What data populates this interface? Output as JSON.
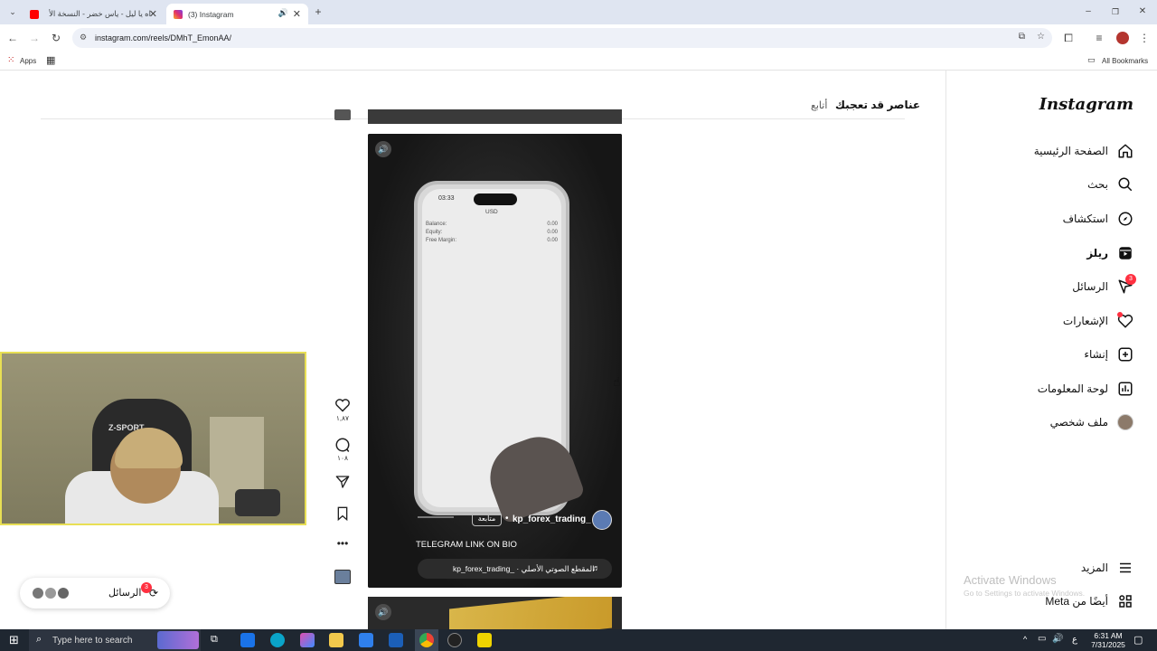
{
  "browser": {
    "tabs": [
      {
        "title": "اه يا ليل - ياس خضر - النسخة الأ"
      },
      {
        "title": "(3) Instagram"
      }
    ],
    "url": "instagram.com/reels/DMhT_EmonAA/",
    "bookmarks": {
      "apps": "Apps",
      "all_bookmarks": "All Bookmarks"
    }
  },
  "sidebar": {
    "logo": "Instagram",
    "items": [
      {
        "label": "الصفحة الرئيسية",
        "icon": "home-icon"
      },
      {
        "label": "بحث",
        "icon": "search-icon"
      },
      {
        "label": "استكشاف",
        "icon": "compass-icon"
      },
      {
        "label": "ريلز",
        "icon": "reels-icon"
      },
      {
        "label": "الرسائل",
        "icon": "messenger-icon",
        "badge": "3"
      },
      {
        "label": "الإشعارات",
        "icon": "heart-icon"
      },
      {
        "label": "إنشاء",
        "icon": "plus-square-icon"
      },
      {
        "label": "لوحة المعلومات",
        "icon": "dashboard-icon"
      },
      {
        "label": "ملف شخصي",
        "icon": "avatar-icon"
      }
    ],
    "more": "المزيد",
    "also_from_meta": "أيضًا من Meta"
  },
  "suggested": {
    "title": "عناصر قد تعجبك",
    "follow": "أتابع"
  },
  "reel": {
    "username": "kp_forex_trading_",
    "follow_label": "متابعة",
    "caption": "TELEGRAM LINK ON BIO",
    "audio": "kp_forex_trading_ · المقطع الصوتي الأصلي",
    "phone": {
      "time": "03:33",
      "currency": "USD",
      "rows": [
        {
          "label": "Balance:",
          "value": "0.00"
        },
        {
          "label": "Equity:",
          "value": "0.00"
        },
        {
          "label": "Free Margin:",
          "value": "0.00"
        }
      ]
    }
  },
  "actions": {
    "likes": "١,٨٧",
    "comments": "١٠٨"
  },
  "messages_pill": {
    "label": "الرسائل",
    "badge": "3"
  },
  "watermark": {
    "line1": "Activate Windows",
    "line2": "Go to Settings to activate Windows."
  },
  "taskbar": {
    "search_placeholder": "Type here to search",
    "time": "6:31 AM",
    "date": "7/31/2025",
    "lang": "ع"
  },
  "webcam": {
    "chair_text": "Z-SPORT"
  }
}
